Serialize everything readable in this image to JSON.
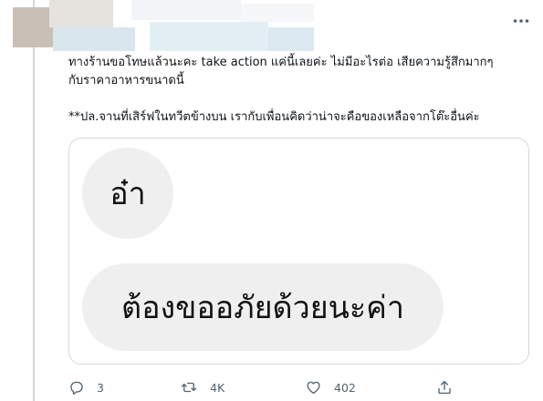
{
  "tweet": {
    "text_line_1": "ทางร้านขอโทษแล้วนะคะ take action แค่นี้เลยค่ะ ไม่มีอะไรต่อ เสียความรู้สึกมากๆ",
    "text_line_2": "กับราคาอาหารขนาดนี้",
    "text_line_3": "**ปล.จานที่เสิร์ฟในทวีตข้างบน เรากับเพื่อนคิดว่าน่าจะคือของเหลือจากโต๊ะอื่นค่ะ"
  },
  "media": {
    "bubble_1": "อ๋า",
    "bubble_2": "ต้องขออภัยด้วยนะค่า"
  },
  "actions": {
    "reply_count": "3",
    "retweet_count": "4K",
    "like_count": "402"
  },
  "icons": {
    "more": "more-horizontal-icon",
    "reply": "reply-icon",
    "retweet": "retweet-icon",
    "like": "heart-icon",
    "share": "share-icon"
  },
  "colors": {
    "text": "#0f1419",
    "secondary": "#536471",
    "border": "#cfd9de",
    "bubble": "#efefef"
  }
}
